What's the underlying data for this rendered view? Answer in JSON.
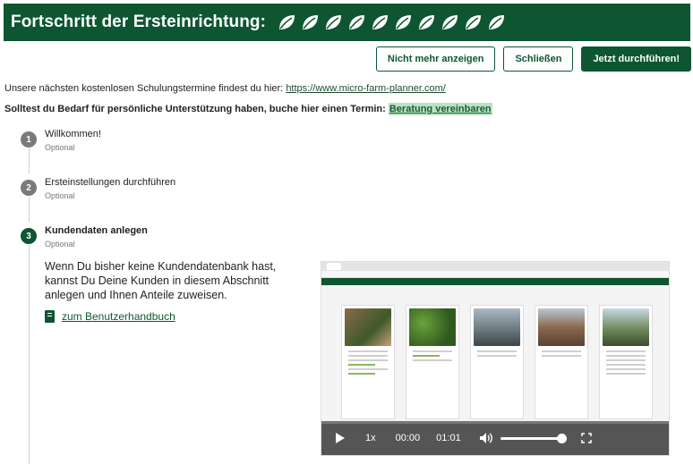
{
  "header": {
    "title": "Fortschritt der Ersteinrichtung:",
    "leaf_icon_count": 10
  },
  "buttons": {
    "dont_show": "Nicht mehr anzeigen",
    "close": "Schließen",
    "run_now": "Jetzt durchführen!"
  },
  "info": {
    "training_text": "Unsere nächsten kostenlosen Schulungstermine findest du hier:",
    "training_link": "https://www.micro-farm-planner.com/",
    "support_text": "Solltest du Bedarf für persönliche Unterstützung haben, buche hier einen Termin:",
    "support_link": "Beratung vereinbaren"
  },
  "steps": [
    {
      "number": "1",
      "title": "Willkommen!",
      "subtitle": "Optional"
    },
    {
      "number": "2",
      "title": "Ersteinstellungen durchführen",
      "subtitle": "Optional"
    },
    {
      "number": "3",
      "title": "Kundendaten anlegen",
      "subtitle": "Optional"
    }
  ],
  "active_step": {
    "description": "Wenn Du bisher keine Kundendatenbank hast, kannst Du Deine Kunden in diesem Abschnitt anlegen und Ihnen Anteile zuweisen.",
    "manual_link": "zum Benutzerhandbuch"
  },
  "video": {
    "speed": "1x",
    "current_time": "00:00",
    "duration": "01:01",
    "volume": 1.0
  },
  "colors": {
    "brand_green": "#0d5631",
    "highlight": "#b8e3c2"
  }
}
